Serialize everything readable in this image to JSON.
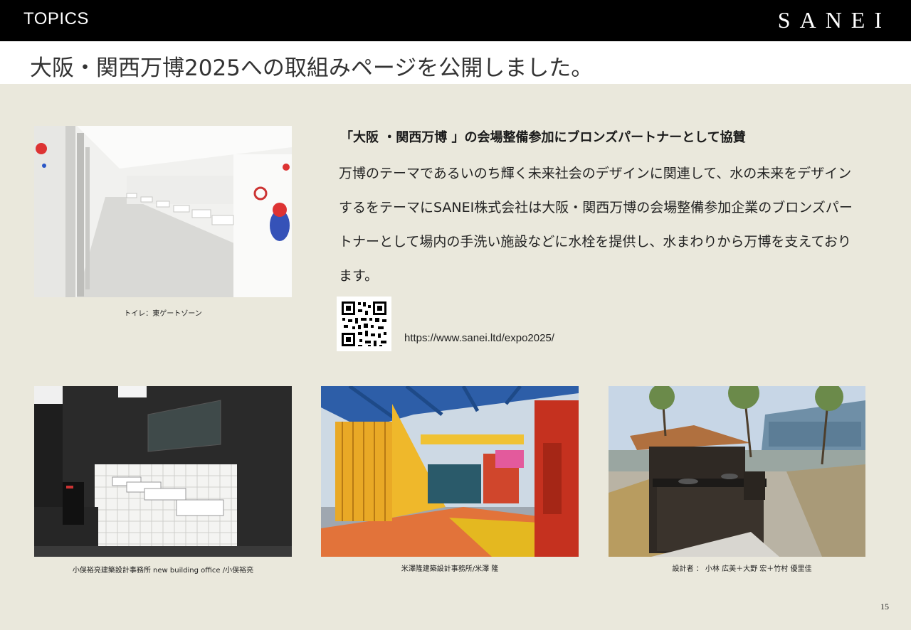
{
  "header": {
    "section_label": "TOPICS",
    "brand": "SANEI"
  },
  "page_title": "大阪・関西万博2025への取組みページを公開しました。",
  "article": {
    "heading": "「大阪 ・関西万博 」の会場整備参加にブロンズパートナーとして協賛",
    "body": "万博のテーマであるいのち輝く未来社会のデザインに関連して、水の未来をデザインするをテーマにSANEI株式会社は大阪・関西万博の会場整備参加企業のブロンズパートナーとして場内の手洗い施設などに水栓を提供し、水まわりから万博を支えております。",
    "url": "https://www.sanei.ltd/expo2025/"
  },
  "photos": [
    {
      "caption": "トイレ：東ゲートゾーン"
    },
    {
      "caption": "小俣裕亮建築設計事務所 new building office /小俣裕亮"
    },
    {
      "caption": "米澤隆建築設計事務所/米澤 隆"
    },
    {
      "caption": "設計者 ： 小林 広美＋大野 宏＋竹村 優里佳"
    }
  ],
  "page_number": "15",
  "colors": {
    "background": "#eae8dc",
    "header": "#000000",
    "title_bar": "#ffffff"
  }
}
